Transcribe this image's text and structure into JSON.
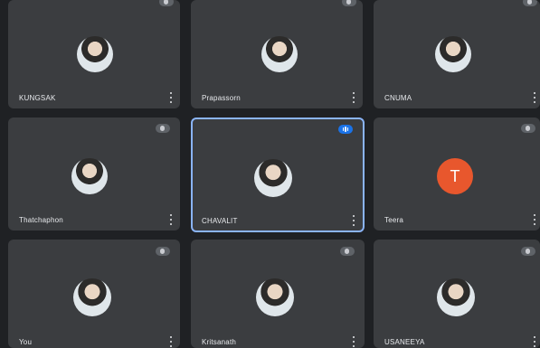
{
  "participants": [
    {
      "name": "KUNGSAK",
      "muted": true,
      "avatar": "photo"
    },
    {
      "name": "Prapassorn",
      "muted": true,
      "avatar": "photo"
    },
    {
      "name": "CNUMA",
      "muted": true,
      "avatar": "photo"
    },
    {
      "name": "Thatchaphon",
      "muted": true,
      "avatar": "photo"
    },
    {
      "name": "CHAVALIT",
      "muted": false,
      "speaking": true,
      "avatar": "photo"
    },
    {
      "name": "Teera",
      "muted": true,
      "avatar": "letter",
      "initial": "T",
      "avatar_color": "#e8572d"
    },
    {
      "name": "You",
      "muted": true,
      "avatar": "photo"
    },
    {
      "name": "Kritsanath",
      "muted": true,
      "avatar": "photo"
    },
    {
      "name": "USANEEYA",
      "muted": true,
      "avatar": "photo"
    }
  ],
  "colors": {
    "tile_bg": "#3b3d40",
    "stage_bg": "#1f2124",
    "active_outline": "#8ab4f8",
    "speaking_badge": "#1a73e8"
  }
}
